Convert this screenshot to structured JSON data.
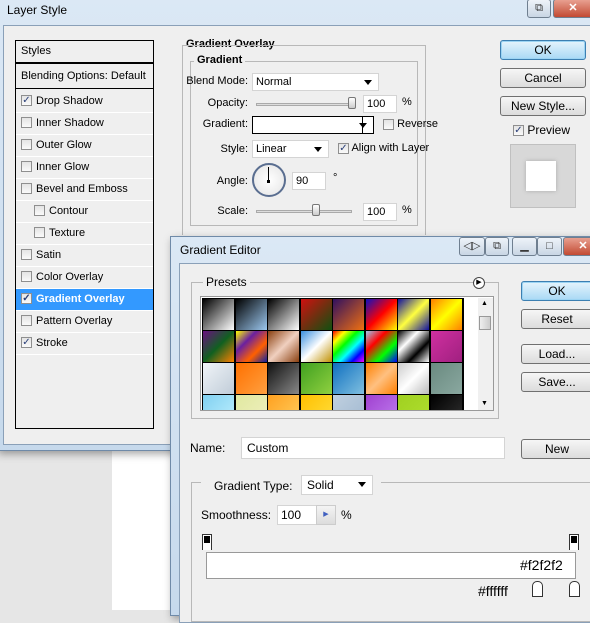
{
  "layer_style": {
    "title": "Layer Style",
    "styles_header": "Styles",
    "blending": "Blending Options: Default",
    "items": [
      {
        "label": "Drop Shadow",
        "checked": true,
        "indent": false
      },
      {
        "label": "Inner Shadow",
        "checked": false,
        "indent": false
      },
      {
        "label": "Outer Glow",
        "checked": false,
        "indent": false
      },
      {
        "label": "Inner Glow",
        "checked": false,
        "indent": false
      },
      {
        "label": "Bevel and Emboss",
        "checked": false,
        "indent": false
      },
      {
        "label": "Contour",
        "checked": false,
        "indent": true
      },
      {
        "label": "Texture",
        "checked": false,
        "indent": true
      },
      {
        "label": "Satin",
        "checked": false,
        "indent": false
      },
      {
        "label": "Color Overlay",
        "checked": false,
        "indent": false
      },
      {
        "label": "Gradient Overlay",
        "checked": true,
        "indent": false,
        "selected": true
      },
      {
        "label": "Pattern Overlay",
        "checked": false,
        "indent": false
      },
      {
        "label": "Stroke",
        "checked": true,
        "indent": false
      }
    ],
    "section_title": "Gradient Overlay",
    "group_title": "Gradient",
    "blend_mode_label": "Blend Mode:",
    "blend_mode": "Normal",
    "opacity_label": "Opacity:",
    "opacity": "100",
    "opacity_unit": "%",
    "gradient_label": "Gradient:",
    "reverse_label": "Reverse",
    "reverse": false,
    "style_label": "Style:",
    "style": "Linear",
    "align_label": "Align with Layer",
    "align": true,
    "angle_label": "Angle:",
    "angle": "90",
    "angle_unit": "°",
    "scale_label": "Scale:",
    "scale": "100",
    "scale_unit": "%",
    "ok": "OK",
    "cancel": "Cancel",
    "new_style": "New Style...",
    "preview_label": "Preview",
    "preview": true
  },
  "gradient_editor": {
    "title": "Gradient Editor",
    "presets_label": "Presets",
    "ok": "OK",
    "reset": "Reset",
    "load": "Load...",
    "save": "Save...",
    "name_label": "Name:",
    "name": "Custom",
    "new": "New",
    "type_label": "Gradient Type:",
    "type": "Solid",
    "smoothness_label": "Smoothness:",
    "smoothness": "100",
    "smoothness_unit": "%",
    "color_right": "#f2f2f2",
    "color_left_stop": "#ffffff",
    "presets": [
      [
        "#000",
        "#fff"
      ],
      [
        "#000",
        "#9cc8f0"
      ],
      [
        "#000",
        "#fff"
      ],
      [
        "#d01010",
        "#105010"
      ],
      [
        "#301060",
        "#f07010"
      ],
      [
        "#1010c0",
        "#ff0000",
        "#ffff00"
      ],
      [
        "#1010a0",
        "#ffff40",
        "#1010a0"
      ],
      [
        "#ff8000",
        "#ffff00",
        "#ff8000"
      ],
      [
        "#6a1080",
        "#106020",
        "#ff8000"
      ],
      [
        "#ffff00",
        "#6a20a0",
        "#ff6000",
        "#1020a0"
      ],
      [
        "#8a4010",
        "#f0d0c0",
        "#8a4010"
      ],
      [
        "#3a90e0",
        "#fff",
        "#c09000"
      ],
      [
        "#ff0000",
        "#ffff00",
        "#00ff00",
        "#00ffff",
        "#0000ff",
        "#ff00ff"
      ],
      [
        "#9cc8f0",
        "#ff0000",
        "#00ff00",
        "#0000ff"
      ],
      [
        "#000",
        "#fff",
        "#000",
        "#fff"
      ],
      [
        "#d030a0",
        "#a02080"
      ],
      [
        "#f0f4f8",
        "#c0ccd8"
      ],
      [
        "#ff7000",
        "#ffa040"
      ],
      [
        "#111",
        "#888"
      ],
      [
        "#40a020",
        "#90d040"
      ],
      [
        "#1070c0",
        "#80c0e0"
      ],
      [
        "#ff8000",
        "#ffc080",
        "#ff8000"
      ],
      [
        "#ccc",
        "#fff",
        "#bbb"
      ],
      [
        "#6a8a80",
        "#8aa8a0"
      ],
      [
        "#80d0f0",
        "#c0f0ff"
      ],
      [
        "#e0e8a0",
        "#f0f0c0"
      ],
      [
        "#ffa020",
        "#ffd060"
      ],
      [
        "#ffc000",
        "#ffe040"
      ],
      [
        "#c0d0e0",
        "#a0b8d0"
      ],
      [
        "#a040d0",
        "#c080f0"
      ],
      [
        "#a0d020",
        "#b0e030"
      ],
      [
        "#000",
        "#333"
      ]
    ]
  }
}
